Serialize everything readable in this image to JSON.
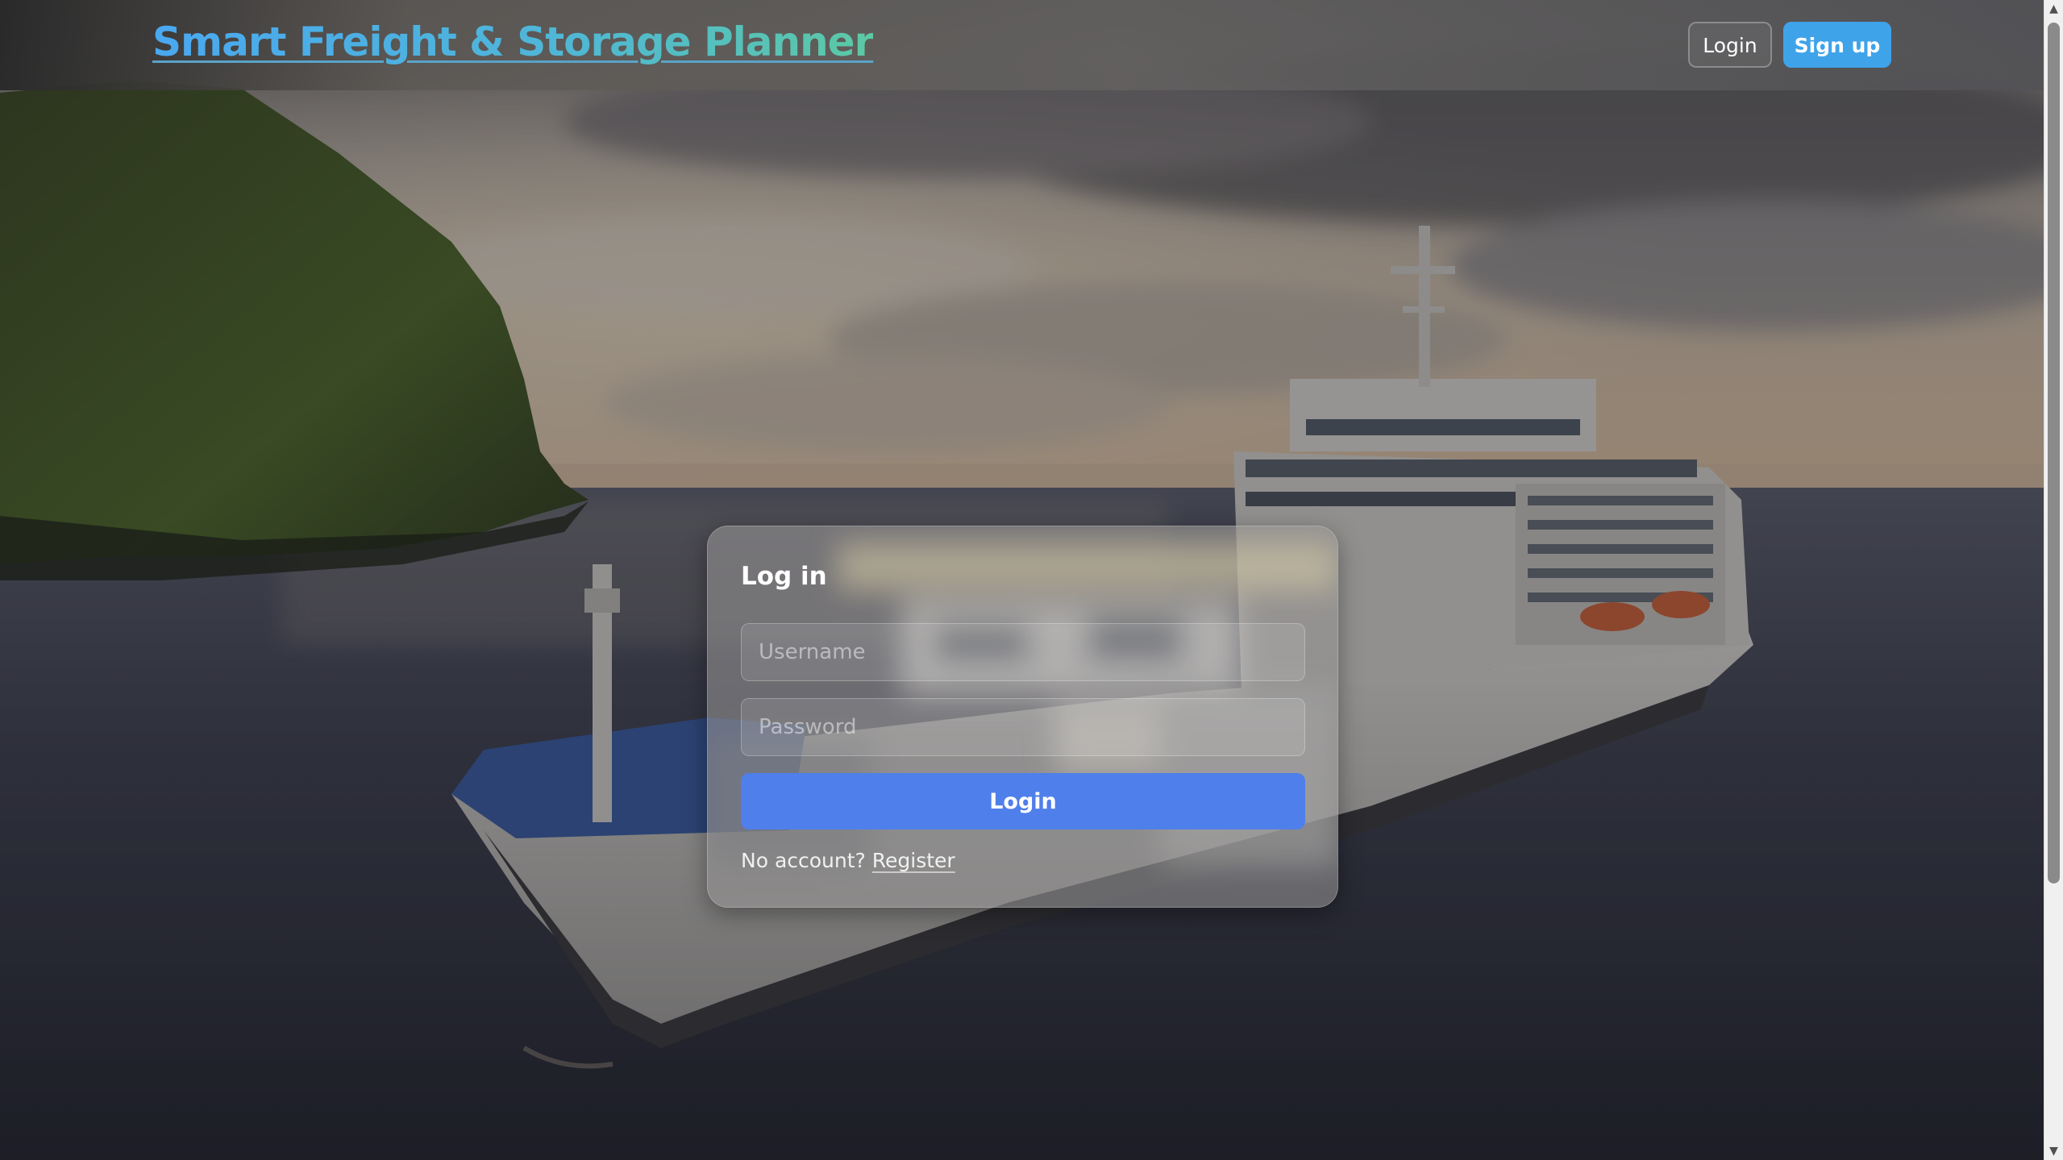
{
  "app": {
    "brand_title": "Smart Freight & Storage Planner"
  },
  "nav": {
    "login_label": "Login",
    "signup_label": "Sign up"
  },
  "login_form": {
    "heading": "Log in",
    "username": {
      "placeholder": "Username",
      "value": ""
    },
    "password": {
      "placeholder": "Password",
      "value": ""
    },
    "submit_label": "Login",
    "no_account_text": "No account?",
    "register_label": "Register"
  },
  "colors": {
    "primary_button": "#4f7fea",
    "signup_button": "#3fa3ea",
    "brand_gradient_start": "#4aa8f0",
    "brand_gradient_end": "#5cc9a4"
  },
  "icons": {
    "scroll_up": "scroll-up-arrow-icon",
    "scroll_down": "scroll-down-arrow-icon"
  }
}
